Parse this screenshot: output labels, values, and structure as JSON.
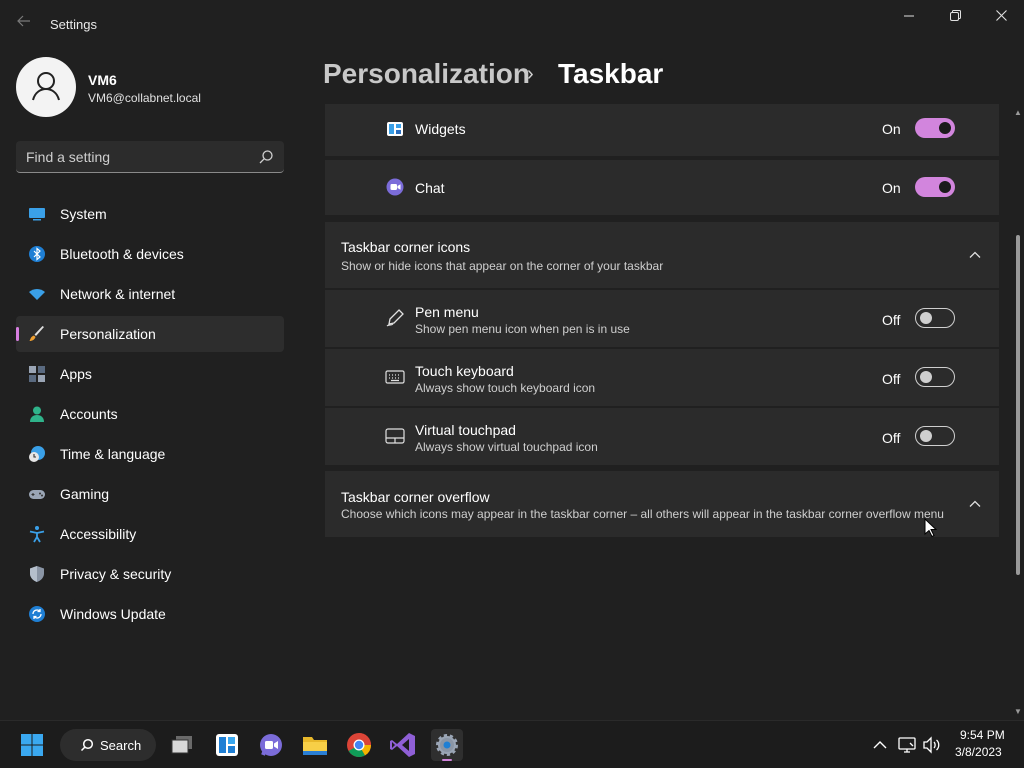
{
  "window": {
    "title": "Settings",
    "back_icon": "back-arrow-icon",
    "minimize_icon": "minimize-icon",
    "restore_icon": "restore-icon",
    "close_icon": "close-icon"
  },
  "profile": {
    "name": "VM6",
    "email": "VM6@collabnet.local",
    "avatar_icon": "user-avatar-icon"
  },
  "search": {
    "placeholder": "Find a setting",
    "value": ""
  },
  "sidebar": {
    "items": [
      {
        "label": "System",
        "icon": "system-icon",
        "active": false
      },
      {
        "label": "Bluetooth & devices",
        "icon": "bluetooth-icon",
        "active": false
      },
      {
        "label": "Network & internet",
        "icon": "wifi-icon",
        "active": false
      },
      {
        "label": "Personalization",
        "icon": "brush-icon",
        "active": true
      },
      {
        "label": "Apps",
        "icon": "apps-icon",
        "active": false
      },
      {
        "label": "Accounts",
        "icon": "accounts-icon",
        "active": false
      },
      {
        "label": "Time & language",
        "icon": "clock-globe-icon",
        "active": false
      },
      {
        "label": "Gaming",
        "icon": "gamepad-icon",
        "active": false
      },
      {
        "label": "Accessibility",
        "icon": "accessibility-icon",
        "active": false
      },
      {
        "label": "Privacy & security",
        "icon": "shield-icon",
        "active": false
      },
      {
        "label": "Windows Update",
        "icon": "update-icon",
        "active": false
      }
    ]
  },
  "breadcrumb": {
    "parent": "Personalization",
    "separator": "›",
    "current": "Taskbar"
  },
  "taskbar_items": {
    "widgets": {
      "label": "Widgets",
      "state": "On",
      "on": true,
      "icon": "widgets-icon"
    },
    "chat": {
      "label": "Chat",
      "state": "On",
      "on": true,
      "icon": "chat-icon"
    }
  },
  "corner_icons": {
    "title": "Taskbar corner icons",
    "subtitle": "Show or hide icons that appear on the corner of your taskbar",
    "items": [
      {
        "label": "Pen menu",
        "desc": "Show pen menu icon when pen is in use",
        "state": "Off",
        "on": false,
        "icon": "pen-icon"
      },
      {
        "label": "Touch keyboard",
        "desc": "Always show touch keyboard icon",
        "state": "Off",
        "on": false,
        "icon": "keyboard-icon"
      },
      {
        "label": "Virtual touchpad",
        "desc": "Always show virtual touchpad icon",
        "state": "Off",
        "on": false,
        "icon": "touchpad-icon"
      }
    ]
  },
  "corner_overflow": {
    "title": "Taskbar corner overflow",
    "subtitle": "Choose which icons may appear in the taskbar corner – all others will appear in the taskbar corner overflow menu"
  },
  "taskbar": {
    "search_label": "Search",
    "apps": [
      "start-icon",
      "task-view-icon",
      "widgets-icon",
      "teams-chat-icon",
      "file-explorer-icon",
      "chrome-icon",
      "visual-studio-icon",
      "settings-gear-icon"
    ],
    "tray": [
      "chevron-up-icon",
      "network-icon",
      "volume-icon"
    ],
    "time": "9:54 PM",
    "date": "3/8/2023"
  },
  "colors": {
    "accent": "#d285dd",
    "background": "#202020",
    "card": "#2b2b2b"
  }
}
